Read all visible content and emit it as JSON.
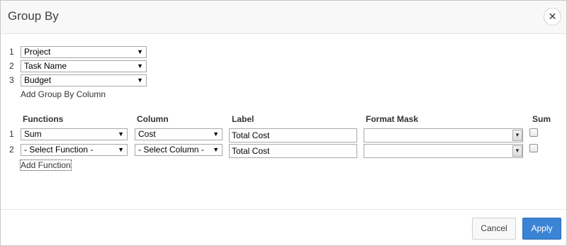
{
  "dialog": {
    "title": "Group By",
    "close_icon": "close-icon"
  },
  "group_by": {
    "rows": [
      {
        "num": "1",
        "value": "Project"
      },
      {
        "num": "2",
        "value": "Task Name"
      },
      {
        "num": "3",
        "value": "Budget"
      }
    ],
    "add_column_label": "Add Group By Column"
  },
  "functions_table": {
    "headers": {
      "functions": "Functions",
      "column": "Column",
      "label": "Label",
      "format_mask": "Format Mask",
      "sum": "Sum"
    },
    "rows": [
      {
        "num": "1",
        "function": "Sum",
        "column": "Cost",
        "label": "Total Cost",
        "format_mask": "",
        "sum_checked": false
      },
      {
        "num": "2",
        "function": "- Select Function -",
        "column": "- Select Column -",
        "label": "Total Cost",
        "format_mask": "",
        "sum_checked": false
      }
    ],
    "add_function_label": "Add Function"
  },
  "footer": {
    "cancel_label": "Cancel",
    "apply_label": "Apply"
  },
  "colors": {
    "apply_button": "#3b83d4",
    "titlebar": "#f8f8f8"
  }
}
